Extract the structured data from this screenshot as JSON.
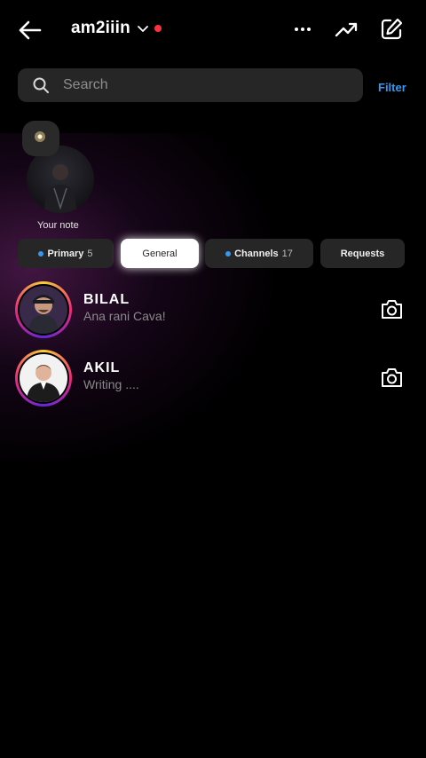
{
  "header": {
    "username": "am2iiin",
    "back_icon": "arrow-left-icon",
    "more_icon": "more-horizontal-icon",
    "trend_icon": "trending-up-icon",
    "compose_icon": "compose-icon",
    "live_dot_color": "#ff3040"
  },
  "search": {
    "placeholder": "Search",
    "filter_label": "Filter"
  },
  "note": {
    "label": "Your note"
  },
  "tabs": [
    {
      "label": "Primary",
      "count": "5",
      "has_dot": true,
      "selected": false
    },
    {
      "label": "General",
      "count": "",
      "has_dot": false,
      "selected": true
    },
    {
      "label": "Channels",
      "count": "17",
      "has_dot": true,
      "selected": false
    },
    {
      "label": "Requests",
      "count": "",
      "has_dot": false,
      "selected": false
    }
  ],
  "conversations": [
    {
      "name": "BILAL",
      "preview": "Ana rani Cava!",
      "action_icon": "camera-icon"
    },
    {
      "name": "AKIL",
      "preview": "Writing ....",
      "action_icon": "camera-icon"
    }
  ],
  "colors": {
    "accent": "#3797f0",
    "background": "#000000",
    "field": "#262626"
  }
}
